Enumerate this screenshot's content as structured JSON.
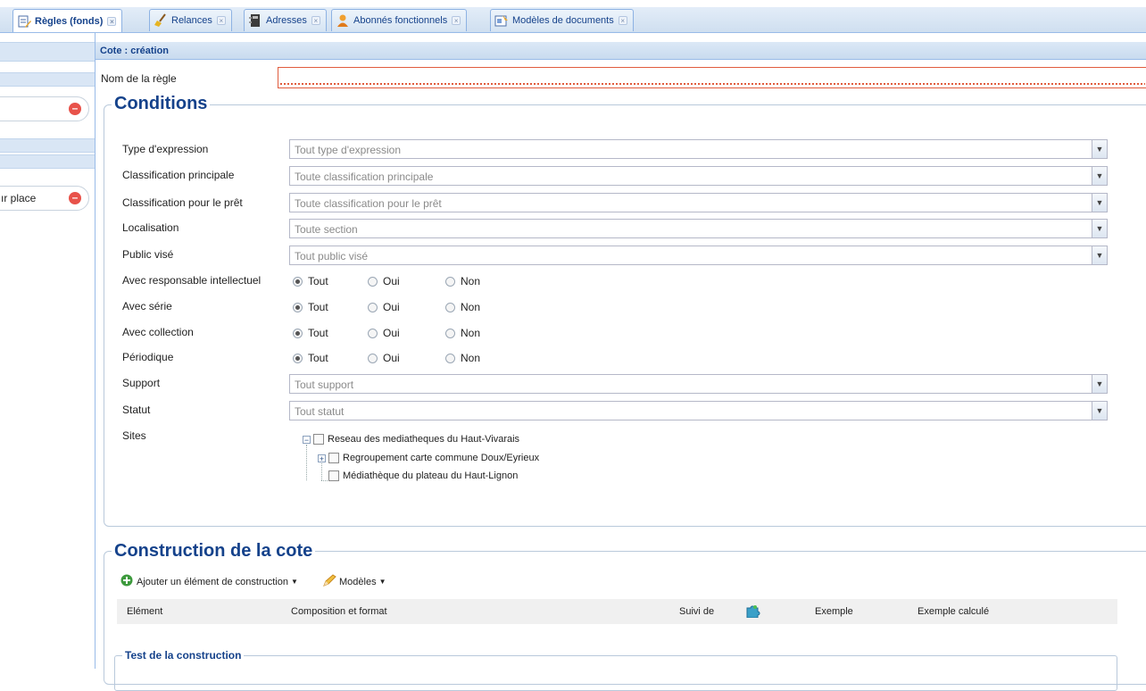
{
  "tabs": [
    {
      "label": "Règles (fonds)",
      "icon": "rules-edit-icon",
      "active": true
    },
    {
      "label": "Relances",
      "icon": "broom-icon",
      "active": false
    },
    {
      "label": "Adresses",
      "icon": "address-book-icon",
      "active": false
    },
    {
      "label": "Abonnés fonctionnels",
      "icon": "users-icon",
      "active": false
    },
    {
      "label": "Modèles de documents",
      "icon": "document-template-icon",
      "active": false
    }
  ],
  "tab_close_glyph": "×",
  "left_panel": {
    "item_partial_label": "ır place"
  },
  "panel": {
    "title": "Cote : création",
    "rule_name_label": "Nom de la règle",
    "rule_name_value": ""
  },
  "conditions": {
    "legend": "Conditions",
    "fields": {
      "type_expression": {
        "label": "Type d'expression",
        "placeholder": "Tout type d'expression"
      },
      "classification_principale": {
        "label": "Classification principale",
        "placeholder": "Toute classification principale"
      },
      "classification_pret": {
        "label": "Classification pour le prêt",
        "placeholder": "Toute classification pour le prêt"
      },
      "localisation": {
        "label": "Localisation",
        "placeholder": "Toute section"
      },
      "public_vise": {
        "label": "Public visé",
        "placeholder": "Tout public visé"
      },
      "support": {
        "label": "Support",
        "placeholder": "Tout support"
      },
      "statut": {
        "label": "Statut",
        "placeholder": "Tout statut"
      }
    },
    "radio_options": [
      "Tout",
      "Oui",
      "Non"
    ],
    "radios": {
      "responsable": {
        "label": "Avec responsable intellectuel",
        "selected": "Tout"
      },
      "serie": {
        "label": "Avec série",
        "selected": "Tout"
      },
      "collection": {
        "label": "Avec collection",
        "selected": "Tout"
      },
      "periodique": {
        "label": "Périodique",
        "selected": "Tout"
      }
    },
    "sites_label": "Sites",
    "sites_tree": {
      "root": "Reseau des mediatheques du Haut-Vivarais",
      "child1": "Regroupement carte commune Doux/Eyrieux",
      "child2": "Médiathèque du plateau du Haut-Lignon"
    }
  },
  "construction": {
    "legend": "Construction de la cote",
    "add_button": "Ajouter un élément de construction",
    "models_button": "Modèles",
    "columns": {
      "element": "Elément",
      "composition": "Composition et format",
      "suivi": "Suivi de",
      "exemple": "Exemple",
      "exemple_calcule": "Exemple calculé"
    },
    "test_legend": "Test de la construction"
  },
  "colors": {
    "accent": "#15428b",
    "border": "#99bbe8",
    "error": "#e05c3e",
    "remove": "#e8524a"
  }
}
